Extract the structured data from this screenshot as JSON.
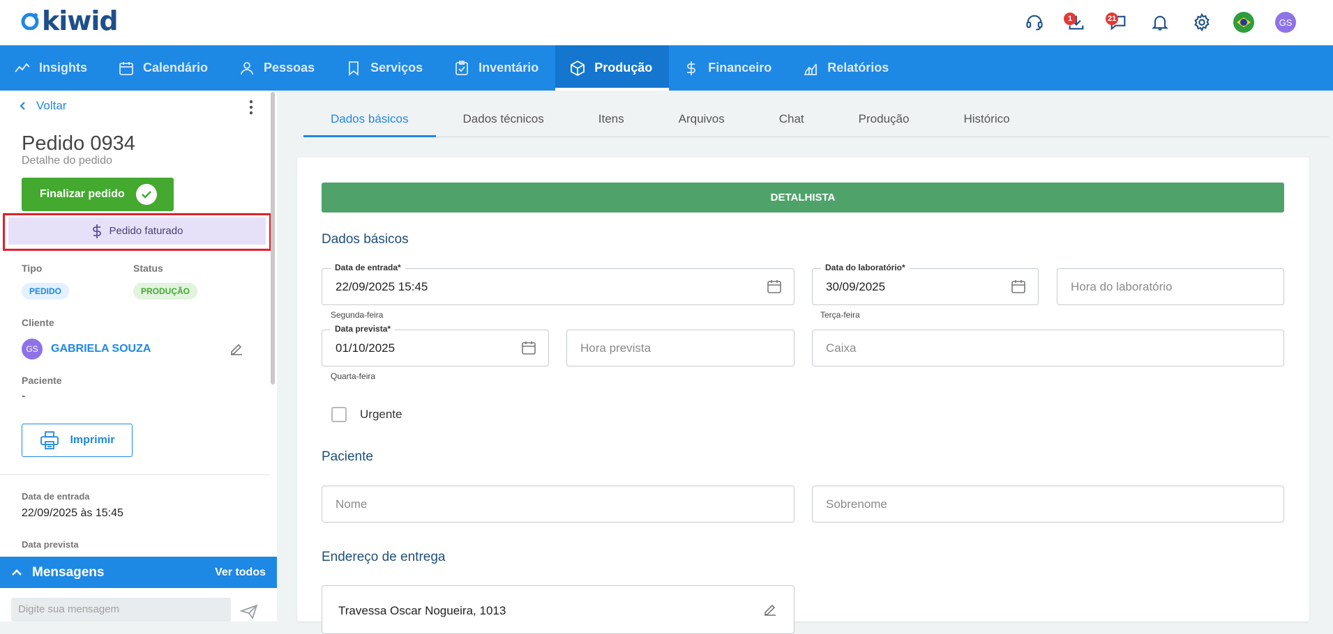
{
  "app": {
    "logo_text": "kiwid"
  },
  "topbar": {
    "icons": [
      "headset-icon",
      "download-icon",
      "chat-icon",
      "bell-icon",
      "gear-icon",
      "brazil-flag-icon"
    ],
    "download_badge": "1",
    "chat_badge": "21",
    "user_initials": "GS"
  },
  "nav": {
    "items": [
      {
        "label": "Insights",
        "icon": "trend-icon"
      },
      {
        "label": "Calendário",
        "icon": "calendar-icon"
      },
      {
        "label": "Pessoas",
        "icon": "person-icon"
      },
      {
        "label": "Serviços",
        "icon": "bookmark-icon"
      },
      {
        "label": "Inventário",
        "icon": "clipboard-check-icon"
      },
      {
        "label": "Produção",
        "icon": "cube-icon"
      },
      {
        "label": "Financeiro",
        "icon": "dollar-icon"
      },
      {
        "label": "Relatórios",
        "icon": "chart-icon"
      }
    ],
    "active": "Produção"
  },
  "left": {
    "back_label": "Voltar",
    "title": "Pedido 0934",
    "subtitle": "Detalhe do pedido",
    "finish_label": "Finalizar pedido",
    "faturado_label": "Pedido faturado",
    "tipo_label": "Tipo",
    "tipo_value": "PEDIDO",
    "status_label": "Status",
    "status_value": "PRODUÇÃO",
    "cliente_label": "Cliente",
    "cliente_initials": "GS",
    "cliente_name": "GABRIELA SOUZA",
    "paciente_label": "Paciente",
    "paciente_value": "-",
    "print_label": "Imprimir",
    "data_entrada_label": "Data de entrada",
    "data_entrada_value": "22/09/2025 às 15:45",
    "data_prevista_label": "Data prevista",
    "messages_title": "Mensagens",
    "messages_all": "Ver todos",
    "message_placeholder": "Digite sua mensagem"
  },
  "tabs": [
    "Dados básicos",
    "Dados técnicos",
    "Itens",
    "Arquivos",
    "Chat",
    "Produção",
    "Histórico"
  ],
  "active_tab": "Dados básicos",
  "form": {
    "banner": "DETALHISTA",
    "section_basic": "Dados básicos",
    "data_entrada_label": "Data de entrada",
    "data_entrada_value": "22/09/2025 15:45",
    "data_entrada_helper": "Segunda-feira",
    "data_lab_label": "Data do laboratório",
    "data_lab_value": "30/09/2025",
    "data_lab_helper": "Terça-feira",
    "hora_lab_placeholder": "Hora do laboratório",
    "data_prevista_label": "Data prevista",
    "data_prevista_value": "01/10/2025",
    "data_prevista_helper": "Quarta-feira",
    "hora_prevista_placeholder": "Hora prevista",
    "caixa_placeholder": "Caixa",
    "urgente_label": "Urgente",
    "section_paciente": "Paciente",
    "nome_placeholder": "Nome",
    "sobrenome_placeholder": "Sobrenome",
    "section_endereco": "Endereço de entrega",
    "endereco_value": "Travessa Oscar Nogueira, 1013"
  },
  "colors": {
    "primary": "#1e88e5",
    "success": "#43a92f",
    "banner": "#4fa36a",
    "highlight_border": "#e0202b",
    "faturado_bg": "#e6e1f8"
  }
}
